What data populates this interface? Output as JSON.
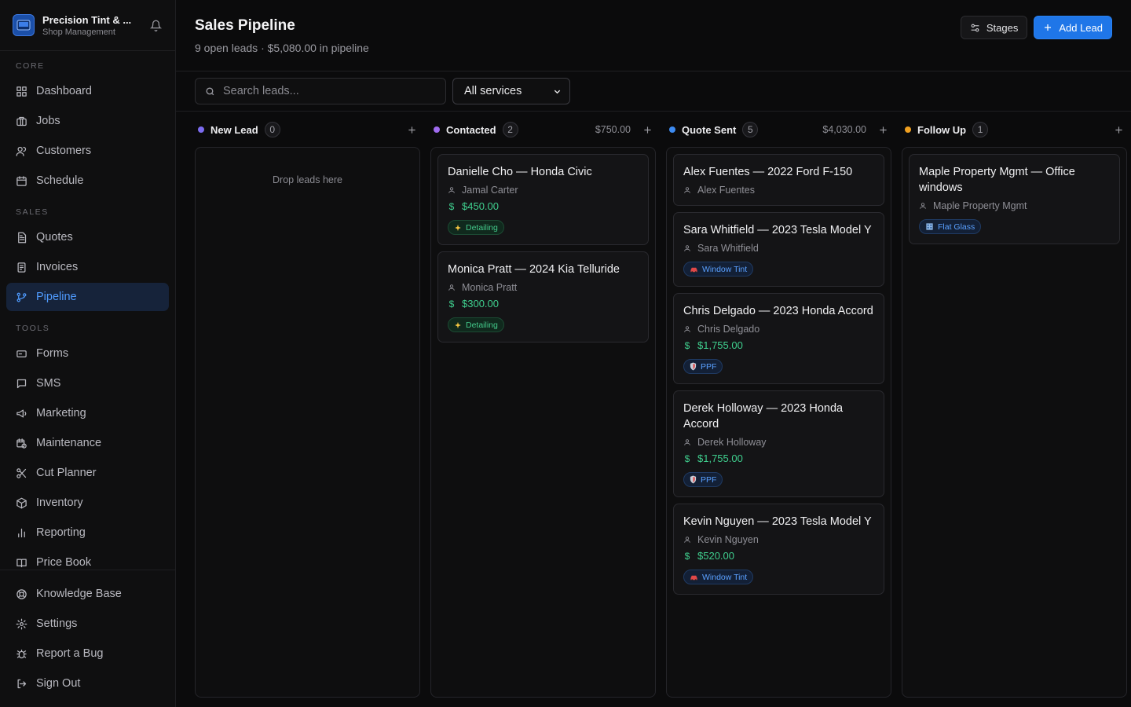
{
  "brand": {
    "name": "Precision Tint & ...",
    "subtitle": "Shop Management"
  },
  "nav": {
    "core_label": "CORE",
    "core": [
      {
        "label": "Dashboard",
        "icon": "dashboard-icon"
      },
      {
        "label": "Jobs",
        "icon": "briefcase-icon"
      },
      {
        "label": "Customers",
        "icon": "users-icon"
      },
      {
        "label": "Schedule",
        "icon": "calendar-icon"
      }
    ],
    "sales_label": "SALES",
    "sales": [
      {
        "label": "Quotes",
        "icon": "document-icon"
      },
      {
        "label": "Invoices",
        "icon": "receipt-icon"
      },
      {
        "label": "Pipeline",
        "icon": "git-branch-icon",
        "active": true
      }
    ],
    "tools_label": "TOOLS",
    "tools": [
      {
        "label": "Forms",
        "icon": "form-icon"
      },
      {
        "label": "SMS",
        "icon": "chat-icon"
      },
      {
        "label": "Marketing",
        "icon": "megaphone-icon"
      },
      {
        "label": "Maintenance",
        "icon": "calendar-clock-icon"
      },
      {
        "label": "Cut Planner",
        "icon": "scissors-icon"
      },
      {
        "label": "Inventory",
        "icon": "package-icon"
      },
      {
        "label": "Reporting",
        "icon": "bar-chart-icon"
      },
      {
        "label": "Price Book",
        "icon": "book-icon"
      }
    ],
    "bottom": [
      {
        "label": "Knowledge Base",
        "icon": "lifebuoy-icon"
      },
      {
        "label": "Settings",
        "icon": "gear-icon"
      },
      {
        "label": "Report a Bug",
        "icon": "bug-icon"
      },
      {
        "label": "Sign Out",
        "icon": "sign-out-icon"
      }
    ]
  },
  "header": {
    "title": "Sales Pipeline",
    "subtitle": "9 open leads · $5,080.00 in pipeline",
    "stages_label": "Stages",
    "add_lead_label": "Add Lead"
  },
  "toolbar": {
    "search_placeholder": "Search leads...",
    "service_filter": "All services"
  },
  "colors": {
    "accent": "#1f76e8",
    "new_lead": "#7c6cf0",
    "contacted": "#a06cf0",
    "quote_sent": "#3d8bf2",
    "follow_up": "#f0a020",
    "money": "#3fcf8e"
  },
  "columns": [
    {
      "name": "New Lead",
      "count": "0",
      "total": "",
      "empty_hint": "Drop leads here",
      "cards": []
    },
    {
      "name": "Contacted",
      "count": "2",
      "total": "$750.00",
      "cards": [
        {
          "title": "Danielle Cho — Honda Civic",
          "contact": "Jamal Carter",
          "amount": "$450.00",
          "tag": "Detailing",
          "tag_icon": "sparkle-icon",
          "tag_style": "green"
        },
        {
          "title": "Monica Pratt — 2024 Kia Telluride",
          "contact": "Monica Pratt",
          "amount": "$300.00",
          "tag": "Detailing",
          "tag_icon": "sparkle-icon",
          "tag_style": "green"
        }
      ]
    },
    {
      "name": "Quote Sent",
      "count": "5",
      "total": "$4,030.00",
      "cards": [
        {
          "title": "Alex Fuentes — 2022 Ford F-150",
          "contact": "Alex Fuentes",
          "amount": "",
          "tag": "",
          "tag_icon": "",
          "tag_style": ""
        },
        {
          "title": "Sara Whitfield — 2023 Tesla Model Y",
          "contact": "Sara Whitfield",
          "amount": "",
          "tag": "Window Tint",
          "tag_icon": "car-icon",
          "tag_style": "blue"
        },
        {
          "title": "Chris Delgado — 2023 Honda Accord",
          "contact": "Chris Delgado",
          "amount": "$1,755.00",
          "tag": "PPF",
          "tag_icon": "shield-icon",
          "tag_style": "blue"
        },
        {
          "title": "Derek Holloway — 2023 Honda Accord",
          "contact": "Derek Holloway",
          "amount": "$1,755.00",
          "tag": "PPF",
          "tag_icon": "shield-icon",
          "tag_style": "blue"
        },
        {
          "title": "Kevin Nguyen — 2023 Tesla Model Y",
          "contact": "Kevin Nguyen",
          "amount": "$520.00",
          "tag": "Window Tint",
          "tag_icon": "car-icon",
          "tag_style": "blue"
        }
      ]
    },
    {
      "name": "Follow Up",
      "count": "1",
      "total": "",
      "cards": [
        {
          "title": "Maple Property Mgmt — Office windows",
          "contact": "Maple Property Mgmt",
          "amount": "",
          "tag": "Flat Glass",
          "tag_icon": "building-icon",
          "tag_style": "blue"
        }
      ]
    }
  ]
}
